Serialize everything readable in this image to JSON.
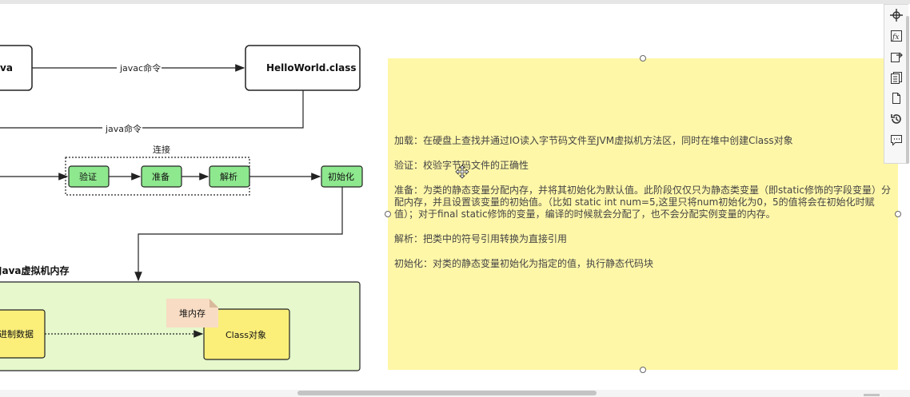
{
  "diagram": {
    "source_file_partial": "va",
    "class_file": "HelloWorld.class",
    "edge_javac": "javac命令",
    "edge_java": "java命令",
    "group_label": "连接",
    "step_verify": "验证",
    "step_prepare": "准备",
    "step_resolve": "解析",
    "step_init": "初始化",
    "jvm_memory_title": "Java虚拟机内存",
    "binary_data_partial": "进制数据",
    "heap_label": "堆内存",
    "class_object": "Class对象"
  },
  "note": {
    "paragraphs": [
      "加载：在硬盘上查找并通过IO读入字节码文件至JVM虚拟机方法区，同时在堆中创建Class对象",
      "验证：校验字节码文件的正确性",
      "准备：为类的静态变量分配内存，并将其初始化为默认值。此阶段仅仅只为静态类变量（即static修饰的字段变量）分配内存，并且设置该变量的初始值。（比如 static int num=5,这里只将num初始化为0，5的值将会在初始化时赋值）；对于final static修饰的变量，编译的时候就会分配了，也不会分配实例变量的内存。",
      "解析：把类中的符号引用转换为直接引用",
      "初始化：对类的静态变量初始化为指定的值，执行静态代码块"
    ]
  },
  "toolbar": {
    "icons": [
      "crosshair-icon",
      "formula-icon",
      "export-icon",
      "pages-icon",
      "file-icon",
      "history-icon",
      "comment-icon"
    ]
  },
  "colors": {
    "note_bg": "#fff7a8",
    "step_fill": "#8ee88e",
    "memory_bg": "#e6f8cc",
    "class_obj_fill": "#fbef7a",
    "heap_fill": "#f8dcc4"
  }
}
